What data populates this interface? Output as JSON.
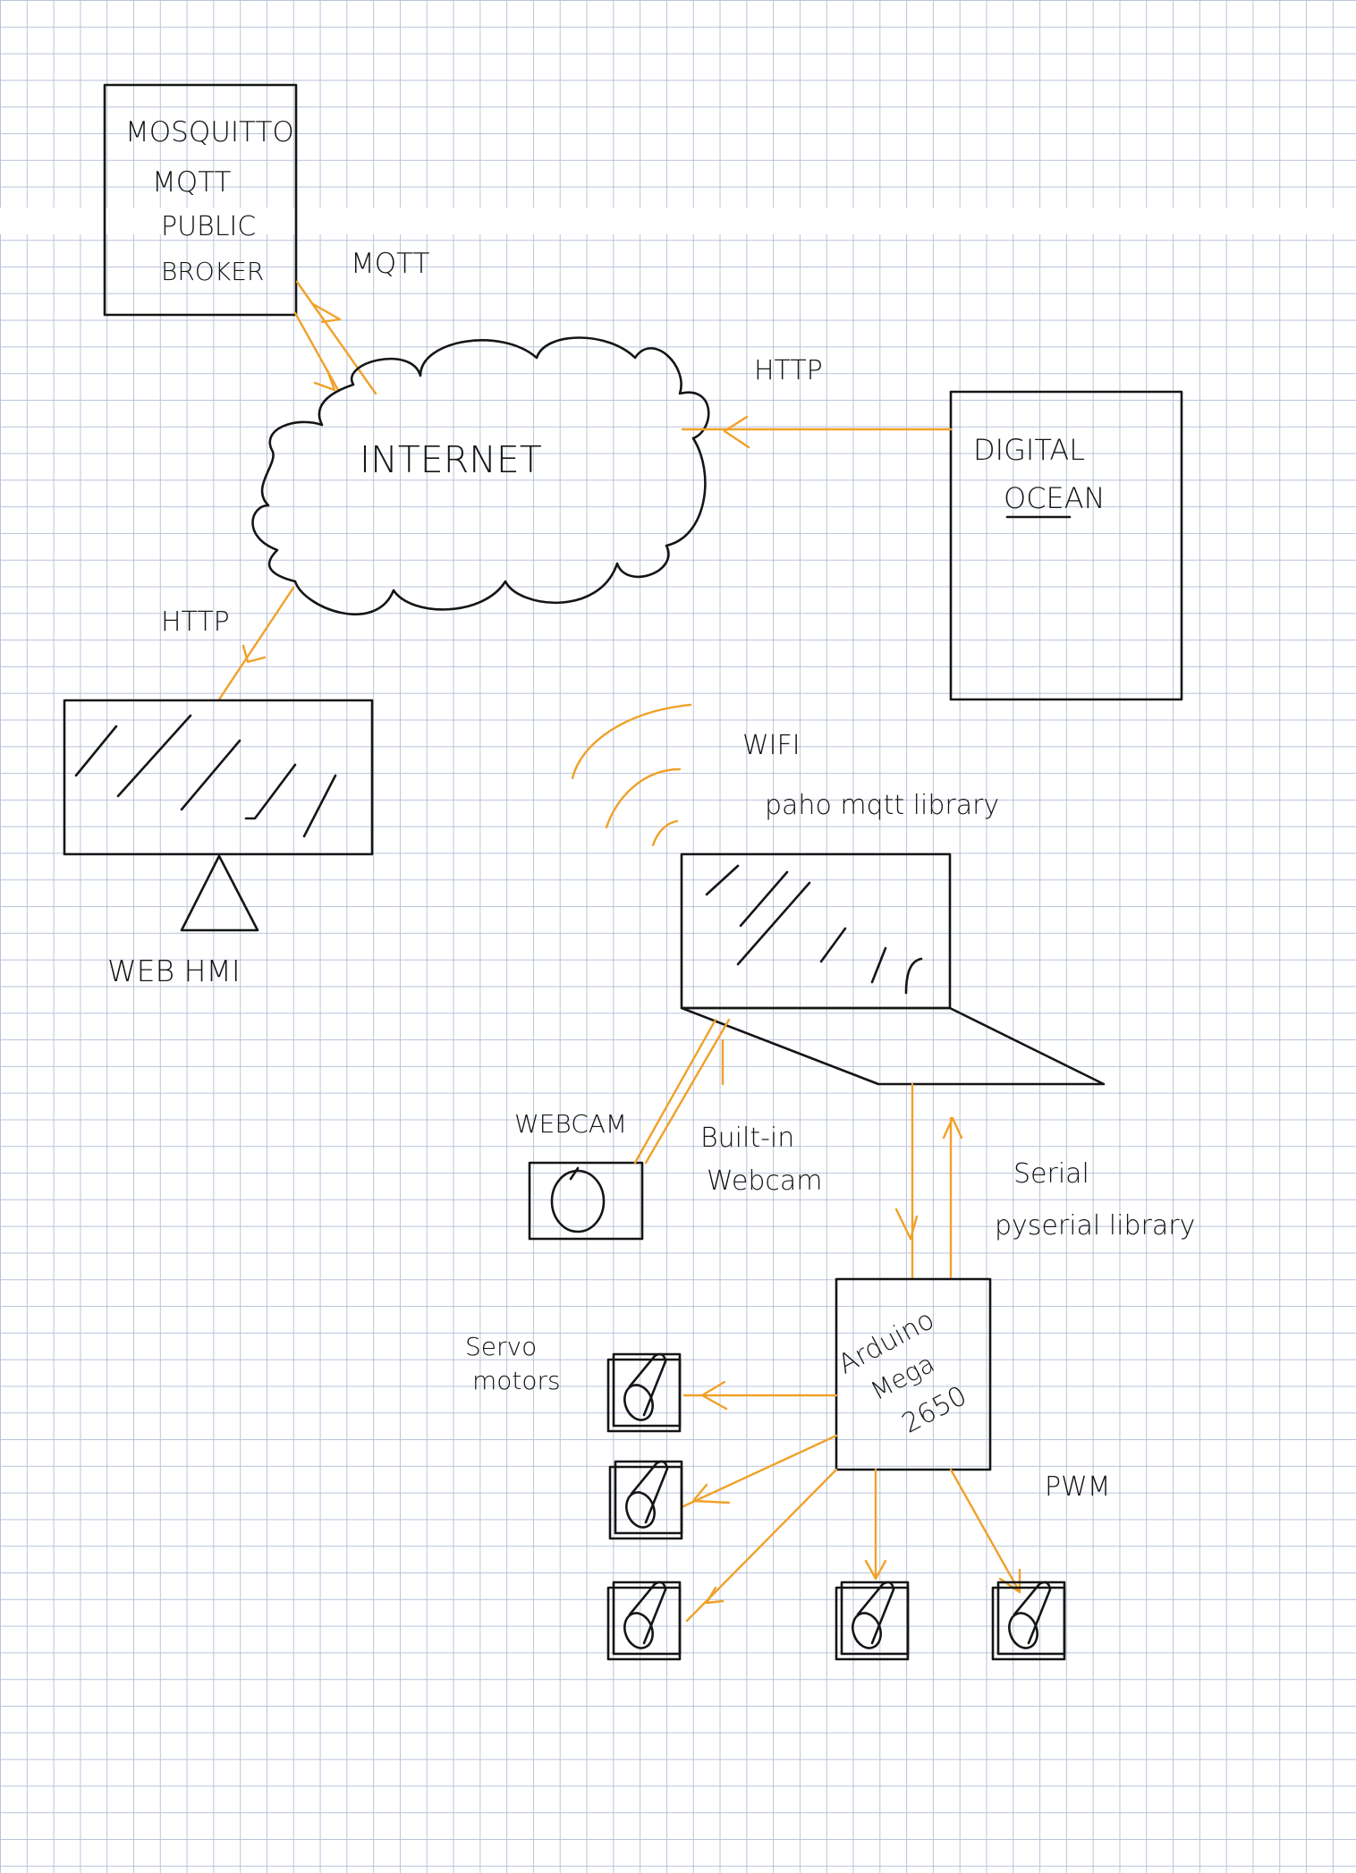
{
  "broker": {
    "line1": "MOSQUITTO",
    "line2": "MQTT",
    "line3": "PUBLIC",
    "line4": "BROKER"
  },
  "internet": {
    "label": "INTERNET"
  },
  "digital_ocean": {
    "line1": "DIGITAL",
    "line2": "OCEAN"
  },
  "web_hmi": {
    "label": "WEB HMI"
  },
  "links": {
    "mqtt": "MQTT",
    "http_do": "HTTP",
    "http_hmi": "HTTP",
    "wifi": "WIFI",
    "paho": "paho mqtt library",
    "serial": "Serial",
    "pyserial": "pyserial library",
    "builtin_line1": "Built-in",
    "builtin_line2": "Webcam",
    "pwm": "PWM"
  },
  "webcam": {
    "label": "WEBCAM"
  },
  "arduino": {
    "line1": "Arduino",
    "line2": "Mega",
    "line3": "2650"
  },
  "servos": {
    "line1": "Servo",
    "line2": "motors"
  },
  "colors": {
    "ink": "#151515",
    "orange": "#f0a129",
    "grid": "#b9c3dc"
  }
}
